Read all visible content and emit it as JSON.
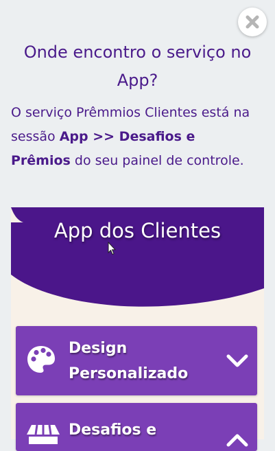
{
  "modal": {
    "close_icon": "close-icon",
    "title": "Onde encontro o serviço no App?",
    "description": {
      "part1": "O serviço Prêmmios Clientes está na sessão ",
      "highlight1": "App >> Desafios e Prêmios",
      "part2": " do seu painel de controle."
    }
  },
  "preview": {
    "title": "App dos Clientes",
    "cards": [
      {
        "label": "Design\nPersonalizado",
        "icon": "palette-icon",
        "toggle_icon": "chevron-down-icon"
      },
      {
        "label": "Desafios e",
        "icon": "storefront-icon",
        "toggle_icon": "chevron-up-icon"
      }
    ]
  },
  "colors": {
    "page_background": "#ECEFF1",
    "heading_purple": "#4A1A8A",
    "banner_purple": "#4B168A",
    "card_purple": "#7B3FB6",
    "panel_cream": "#F8F1E8"
  }
}
